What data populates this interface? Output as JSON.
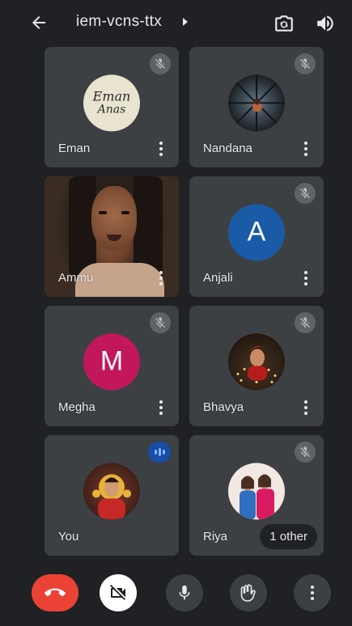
{
  "header": {
    "meeting_code": "iem-vcns-ttx"
  },
  "participants": [
    {
      "name": "Eman",
      "muted": true,
      "avatar_type": "photo",
      "avatar_text_line1": "Eman",
      "avatar_text_line2": "Anas"
    },
    {
      "name": "Nandana",
      "muted": true,
      "avatar_type": "photo"
    },
    {
      "name": "Ammu",
      "muted": false,
      "avatar_type": "video"
    },
    {
      "name": "Anjali",
      "muted": true,
      "avatar_type": "letter",
      "letter": "A",
      "color": "#1a5ba8"
    },
    {
      "name": "Megha",
      "muted": true,
      "avatar_type": "letter",
      "letter": "M",
      "color": "#c2185b"
    },
    {
      "name": "Bhavya",
      "muted": true,
      "avatar_type": "photo"
    },
    {
      "name": "You",
      "muted": false,
      "speaking": true,
      "avatar_type": "photo"
    },
    {
      "name": "Riya",
      "muted": true,
      "avatar_type": "photo",
      "others_label": "1 other"
    }
  ],
  "icons": {
    "back": "arrow-left-icon",
    "flip_camera": "flip-camera-icon",
    "speaker": "volume-icon",
    "end_call": "phone-hangup-icon",
    "camera_off": "video-off-icon",
    "mic": "mic-icon",
    "raise_hand": "hand-icon",
    "more": "more-vert-icon",
    "mic_off": "mic-off-icon"
  },
  "colors": {
    "background": "#202124",
    "tile": "#3c4043",
    "end_call": "#ea4335",
    "speaking": "#174ea6"
  }
}
